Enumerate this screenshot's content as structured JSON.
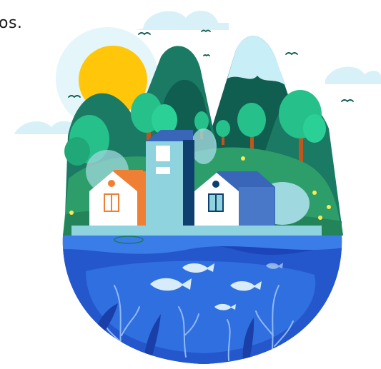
{
  "caption": {
    "text": "os."
  },
  "scene": {
    "subject": "eco-landscape-illustration",
    "colors": {
      "sky_light": "#cdeff7",
      "sun": "#ffc60a",
      "mountain_dark": "#0f5e4f",
      "mountain_mid": "#1b7a63",
      "snow_cap": "#c8eef8",
      "tree_green": "#26c08a",
      "tree_trunk": "#c0551e",
      "ground": "#2d9e6a",
      "house_orange": "#f07f36",
      "house_blue": "#3966b8",
      "building_teal": "#8fd3de",
      "water_deep": "#1d44b8",
      "water_mid": "#2f6fe0",
      "fish": "#d7ecf8",
      "seaweed": "#8fb8f5",
      "flower": "#ffe94d"
    }
  }
}
